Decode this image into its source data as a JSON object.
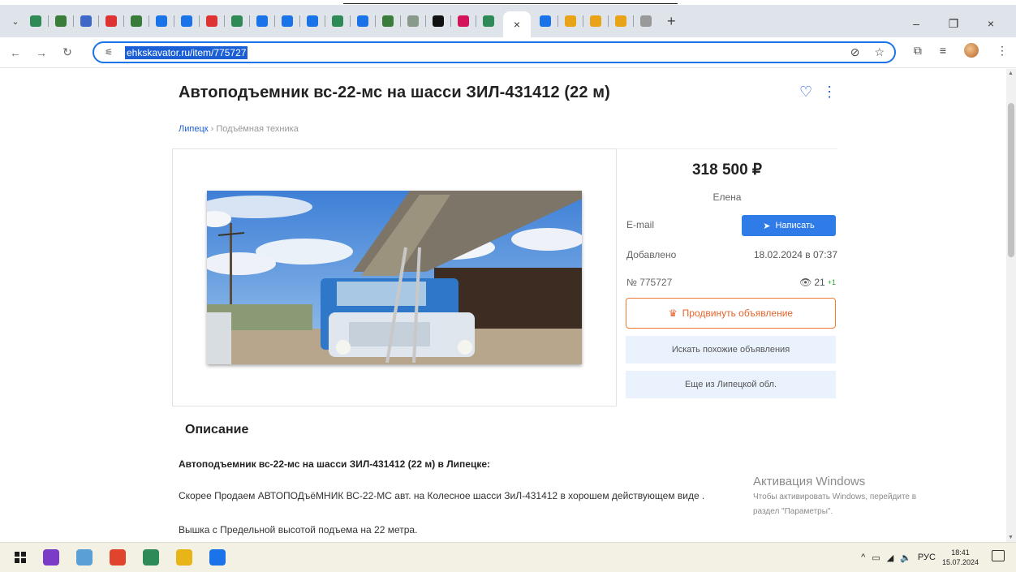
{
  "browser": {
    "tab_close_glyph": "×",
    "new_tab_glyph": "+",
    "window_controls": [
      "–",
      "❐",
      "×"
    ],
    "url": "ehkskavator.ru/item/775727",
    "tab_favicon_colors": [
      "#2e8b57",
      "#3a7d3a",
      "#3d68c7",
      "#d33",
      "#3a7d3a",
      "#1a73e8",
      "#1a73e8",
      "#d33",
      "#2e8b57",
      "#1a73e8",
      "#1a73e8",
      "#1a73e8",
      "#2e8b57",
      "#1a73e8",
      "#3a7d3a",
      "#8a9a8a",
      "#111",
      "#d4145a",
      "#2e8b57",
      "#1a73e8",
      "#e8a317",
      "#e8a317",
      "#e8a317",
      "#999"
    ]
  },
  "listing": {
    "title": "Автоподъемник вс-22-мс на шасси ЗИЛ-431412 (22 м)",
    "favorite_icon": "heart-icon",
    "menu_icon": "kebab-menu-icon",
    "breadcrumb": {
      "city": "Липецк",
      "separator": "›",
      "category": "Подъёмная техника"
    },
    "price": "318 500 ₽",
    "seller": "Елена",
    "email_label": "E-mail",
    "write_button": "Написать",
    "added_label": "Добавлено",
    "added_value": "18.02.2024 в 07:37",
    "number_label": "№ 775727",
    "views": "21",
    "views_delta": "+1",
    "promote_button": "Продвинуть объявление",
    "similar_button": "Искать похожие объявления",
    "more_button": "Еще из Липецкой обл."
  },
  "description": {
    "heading": "Описание",
    "subheading": "Автоподъемник вс-22-мс на шасси ЗИЛ-431412 (22 м) в Липецке:",
    "para1": "Скорее Продаем АВТОПОДъёМНИК ВС-22-МС авт. на Колесное шасси ЗиЛ-431412 в хорошем действующем виде .",
    "para2": "Вышка с Предельной высотой подъема на 22 метра."
  },
  "watermark": {
    "title": "Активация Windows",
    "line1": "Чтобы активировать Windows, перейдите в",
    "line2": "раздел \"Параметры\"."
  },
  "taskbar": {
    "tray_lang": "РУС",
    "time": "18:41",
    "date": "15.07.2024",
    "app_colors": [
      "#7a3cc7",
      "#5aa0d6",
      "#e0442c",
      "#2e8b57",
      "#e8b417",
      "#1a73e8"
    ]
  }
}
